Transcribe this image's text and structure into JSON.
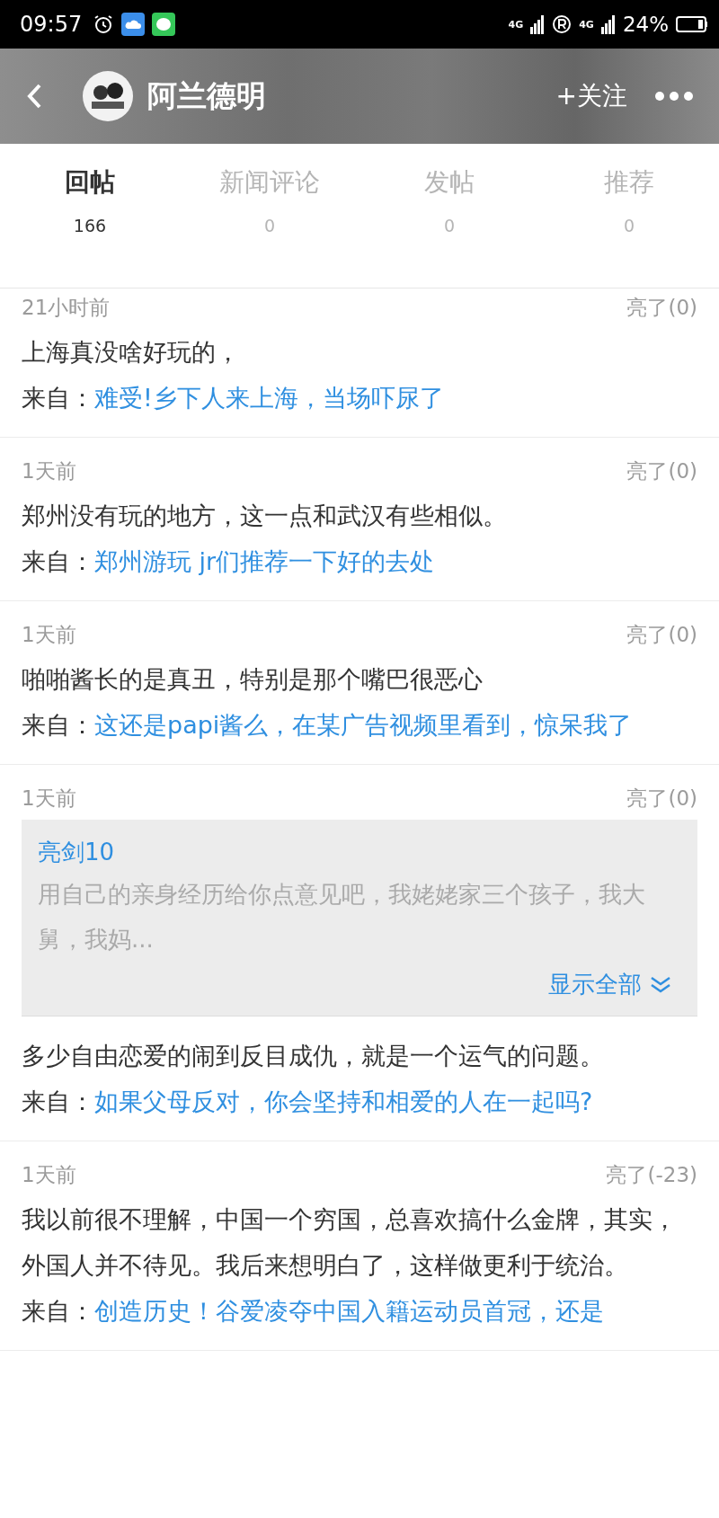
{
  "status_bar": {
    "time": "09:57",
    "network_1": "4G",
    "network_2": "4G",
    "battery_percent": "24%"
  },
  "header": {
    "title": "阿兰德明",
    "follow": "+关注"
  },
  "tabs": [
    {
      "label": "回帖",
      "count": "166",
      "selected": true
    },
    {
      "label": "新闻评论",
      "count": "0",
      "selected": false
    },
    {
      "label": "发帖",
      "count": "0",
      "selected": false
    },
    {
      "label": "推荐",
      "count": "0",
      "selected": false
    }
  ],
  "posts": [
    {
      "time": "21小时前",
      "likes": "亮了(0)",
      "text": "上海真没啥好玩的，",
      "source_label": "来自：",
      "source": "难受!乡下人来上海，当场吓尿了"
    },
    {
      "time": "1天前",
      "likes": "亮了(0)",
      "text": "郑州没有玩的地方，这一点和武汉有些相似。",
      "source_label": "来自：",
      "source": "郑州游玩 jr们推荐一下好的去处"
    },
    {
      "time": "1天前",
      "likes": "亮了(0)",
      "text": "啪啪酱长的是真丑，特别是那个嘴巴很恶心",
      "source_label": "来自：",
      "source": "这还是papi酱么，在某广告视频里看到，惊呆我了"
    },
    {
      "time": "1天前",
      "likes": "亮了(0)",
      "quote": {
        "author": "亮剑10",
        "text": "用自己的亲身经历给你点意见吧，我姥姥家三个孩子，我大舅，我妈...",
        "expand": "显示全部"
      },
      "text": "多少自由恋爱的闹到反目成仇，就是一个运气的问题。",
      "source_label": "来自：",
      "source": "如果父母反对，你会坚持和相爱的人在一起吗?"
    },
    {
      "time": "1天前",
      "likes": "亮了(-23)",
      "text": "我以前很不理解，中国一个穷国，总喜欢搞什么金牌，其实，外国人并不待见。我后来想明白了，这样做更利于统治。",
      "source_label": "来自：",
      "source": "创造历史！谷爱凌夺中国入籍运动员首冠，还是"
    }
  ]
}
